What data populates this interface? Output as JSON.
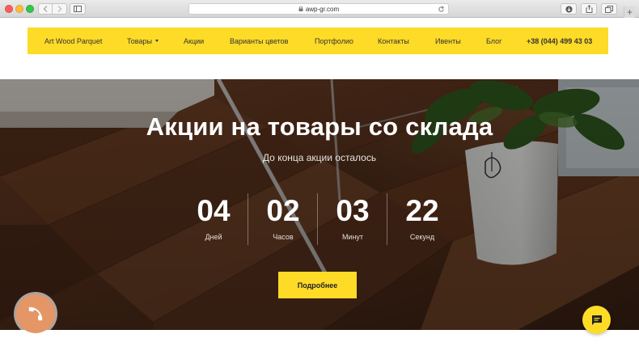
{
  "browser": {
    "url": "awp-gr.com",
    "new_tab_label": "+"
  },
  "header": {
    "brand": "Art Wood Parquet",
    "nav": [
      {
        "label": "Товары"
      },
      {
        "label": "Акции"
      },
      {
        "label": "Варианты цветов"
      },
      {
        "label": "Портфолио"
      },
      {
        "label": "Контакты"
      },
      {
        "label": "Ивенты"
      },
      {
        "label": "Блог"
      }
    ],
    "phone": "+38 (044) 499 43 03",
    "accent_color": "#fddb27"
  },
  "hero": {
    "title": "Акции на товары со склада",
    "subtitle": "До конца акции осталось",
    "countdown": [
      {
        "value": "04",
        "label": "Дней"
      },
      {
        "value": "02",
        "label": "Часов"
      },
      {
        "value": "03",
        "label": "Минут"
      },
      {
        "value": "22",
        "label": "Секунд"
      }
    ],
    "cta_label": "Подробнее"
  },
  "floating": {
    "call_icon": "phone-icon",
    "call_color": "#e59667",
    "chat_icon": "chat-icon"
  }
}
